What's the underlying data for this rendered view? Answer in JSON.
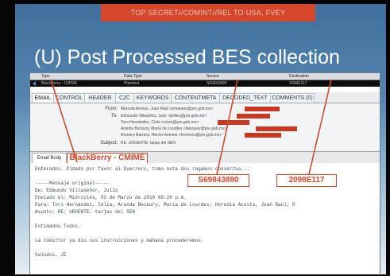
{
  "slide": {
    "classification": "TOP SECRET//COMINT//REL TO USA, FVEY",
    "title": "(U) Post Processed BES collection"
  },
  "grid": {
    "headers": [
      "Type",
      "Data Type",
      "Source",
      "Destination"
    ],
    "row": {
      "type": "BlackBerry - CMIME",
      "data_type": "Plaintext",
      "source": "S69843880",
      "destination": "2098E117"
    }
  },
  "tabs": [
    "EMAIL",
    "CONTROL",
    "HEADER",
    "C2C",
    "KEYWORDS",
    "CONTENTMETA",
    "DECODED_TEXT",
    "COMMENTS (0)"
  ],
  "meta": {
    "from_label": "From:",
    "to_label": "To:",
    "subject_label": "Subject:",
    "from_value": "Marcela Arenas, Juan Raúl <jrmaneni@pre.gob.mx>",
    "to_values": [
      "Edmundo Villaseñor, Julio <jlvilles@pre.gob.mx>",
      "Toro Hernández, Celia <ctoro@pre.gob.mx>",
      "Aranda Bezaury, María de Lourdes <lbezaury@pre.gob.mx>",
      "Romero Barrera, Héctor Antonio <hromero@pre.gob.mx>"
    ],
    "subject_value": "RE: URGENTE: tarjas del SEN"
  },
  "subtabs": {
    "email_body": "Email Body",
    "blackberry": "BlackBerry - CMIME"
  },
  "body": {
    "lines": [
      "Enterados. Pidado por favor al Guerrero, tomo nota dos ragamos consertva...",
      "",
      "-----Mensaje original-----",
      "De: Edmundo Villaseñor, Julio",
      "Enviado el: Miércoles, 03 de Marzo de 2010 09:20 p.m.",
      "Para: Toro Hernández, Celia; Aranda Bezaury, María de Lourdes; Heredia Acosta, Juan Raúl; R",
      "Asunto: RE: URGENTE: tarjas del SEN",
      "",
      "Estimados Todos.",
      "",
      "La tomittor ya dio sus instrucciones y mañana procederemos.",
      "",
      "Saludos.  JE"
    ]
  },
  "callouts": {
    "source": "S69843880",
    "destination": "2098E117"
  },
  "colors": {
    "accent_red": "#d0492d",
    "classification_bar": "#d6462b",
    "slide_blue": "#4f7fab"
  }
}
